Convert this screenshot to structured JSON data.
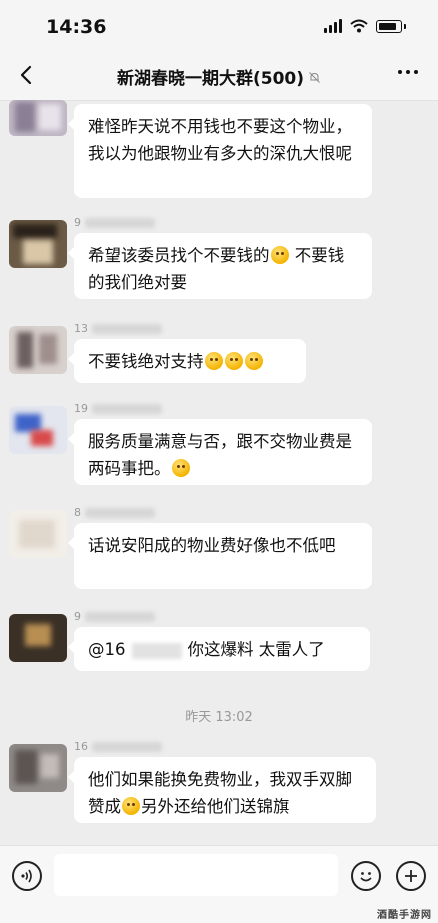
{
  "status_bar": {
    "time": "14:36"
  },
  "header": {
    "title": "新湖春晓一期大群(500)"
  },
  "messages": [
    {
      "sender": "",
      "text": "难怪昨天说不用钱也不要这个物业，我以为他跟物业有多大的深仇大恨呢"
    },
    {
      "sender": "9",
      "text_a": "希望该委员找个不要钱的",
      "text_b": "  不要钱的我们绝对要"
    },
    {
      "sender": "13",
      "text": "不要钱绝对支持"
    },
    {
      "sender": "19",
      "text": "服务质量满意与否，跟不交物业费是两码事把。"
    },
    {
      "sender": "8",
      "text": "话说安阳成的物业费好像也不低吧"
    },
    {
      "sender": "9",
      "text_a": "@16",
      "text_b": "你这爆料 太雷人了"
    },
    {
      "sender": "16",
      "text_a": "他们如果能换免费物业，我双手双脚赞成",
      "text_b": "另外还给他们送锦旗"
    }
  ],
  "timestamp": "昨天 13:02",
  "watermark": "酒酷手游网",
  "colors": {
    "background": "#ededed",
    "bubble": "#ffffff",
    "text": "#111111",
    "meta": "#999999"
  }
}
